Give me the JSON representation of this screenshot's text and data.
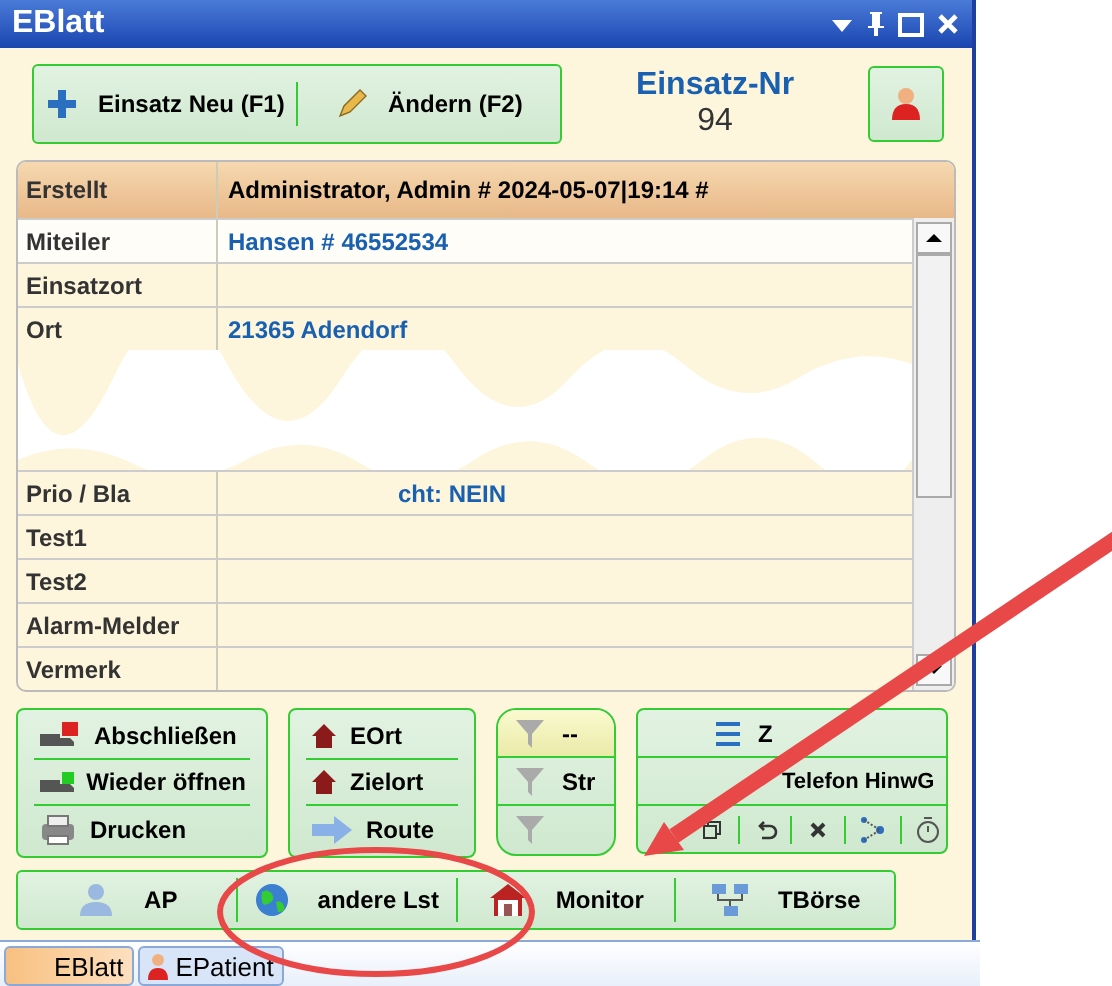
{
  "window": {
    "title": "EBlatt"
  },
  "toolbar": {
    "buttons": [
      "Einsatz Neu (F1)",
      "Ändern (F2)"
    ],
    "number_label": "Einsatz-Nr",
    "number": "94"
  },
  "table": {
    "header": {
      "label": "Erstellt",
      "value": "Administrator, Admin # 2024-05-07|19:14 #"
    },
    "rows_top": [
      {
        "label": "Miteiler",
        "value": "Hansen # 46552534"
      },
      {
        "label": "Einsatzort"
      },
      {
        "label": "Ort",
        "value": "21365 Adendorf"
      }
    ],
    "rows_bottom": [
      {
        "label": "Prio / Bla",
        "value": "cht: NEIN"
      },
      {
        "label": "Test1"
      },
      {
        "label": "Test2"
      },
      {
        "label": "Alarm-Melder"
      },
      {
        "label": "Vermerk"
      }
    ]
  },
  "actions": [
    [
      "Abschließen",
      "Wieder öffnen",
      "Drucken"
    ],
    [
      "EOrt",
      "Zielort",
      "Route"
    ]
  ],
  "filters": [
    {
      "label": "--",
      "selected": true
    },
    {
      "label": "Str",
      "selected": false
    },
    {
      "selected": false
    }
  ],
  "tools": [
    "Z",
    "Telefon HinwG"
  ],
  "bottom_buttons": [
    "AP",
    "andere Lst",
    "Monitor",
    "TBörse"
  ],
  "tabs": [
    {
      "label": "EBlatt",
      "selected": true
    },
    {
      "label": "EPatient",
      "selected": false
    }
  ]
}
